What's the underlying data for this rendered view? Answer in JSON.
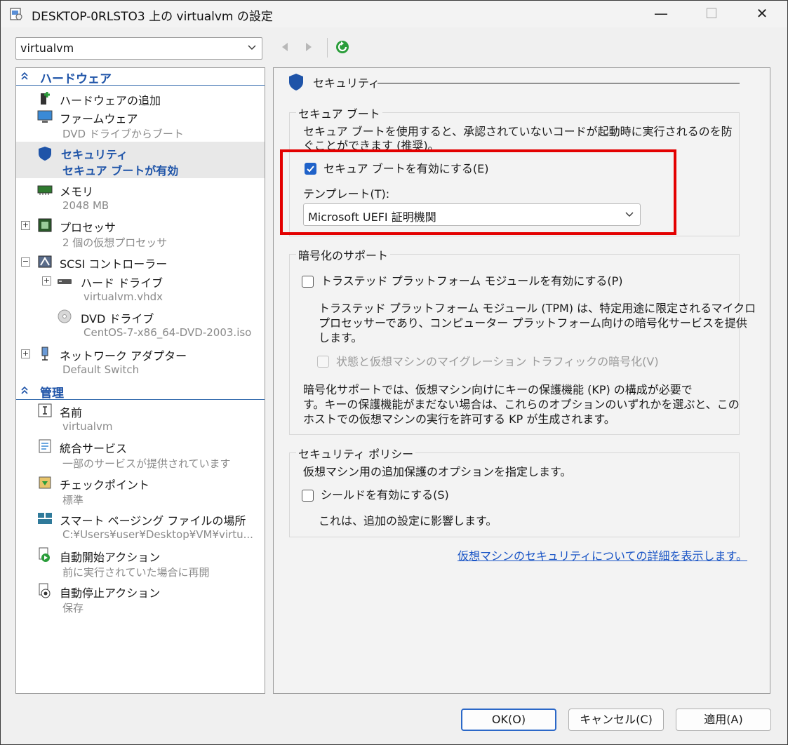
{
  "window": {
    "title": "DESKTOP-0RLSTO3 上の virtualvm の設定",
    "minimize": "—",
    "maximize": "☐",
    "close": "✕"
  },
  "vm_selector": {
    "value": "virtualvm"
  },
  "tree": {
    "hardware_header": "ハードウェア",
    "items": [
      {
        "label": "ハードウェアの追加",
        "sub": ""
      },
      {
        "label": "ファームウェア",
        "sub": "DVD ドライブからブート"
      },
      {
        "label": "セキュリティ",
        "sub": "セキュア ブートが有効"
      },
      {
        "label": "メモリ",
        "sub": "2048 MB"
      },
      {
        "label": "プロセッサ",
        "sub": "2 個の仮想プロセッサ"
      },
      {
        "label": "SCSI コントローラー",
        "sub": ""
      },
      {
        "label": "ハード ドライブ",
        "sub": "virtualvm.vhdx"
      },
      {
        "label": "DVD ドライブ",
        "sub": "CentOS-7-x86_64-DVD-2003.iso"
      },
      {
        "label": "ネットワーク アダプター",
        "sub": "Default Switch"
      }
    ],
    "management_header": "管理",
    "mgmt_items": [
      {
        "label": "名前",
        "sub": "virtualvm"
      },
      {
        "label": "統合サービス",
        "sub": "一部のサービスが提供されています"
      },
      {
        "label": "チェックポイント",
        "sub": "標準"
      },
      {
        "label": "スマート ページング ファイルの場所",
        "sub": "C:¥Users¥user¥Desktop¥VM¥virtu..."
      },
      {
        "label": "自動開始アクション",
        "sub": "前に実行されていた場合に再開"
      },
      {
        "label": "自動停止アクション",
        "sub": "保存"
      }
    ]
  },
  "security": {
    "title": "セキュリティ",
    "secure_boot": {
      "group_label": "セキュア ブート",
      "desc_line1": "セキュア ブートを使用すると、承認されていないコードが起動時に実行されるのを防",
      "desc_line2": "ぐことができます (推奨)。",
      "enable_label": "セキュア ブートを有効にする(E)",
      "enabled": true,
      "template_label": "テンプレート(T):",
      "template_value": "Microsoft UEFI 証明機関"
    },
    "encryption": {
      "group_label": "暗号化のサポート",
      "tpm_label": "トラステッド プラットフォーム モジュールを有効にする(P)",
      "tpm_enabled": false,
      "tpm_desc_line1": "トラステッド プラットフォーム モジュール (TPM) は、特定用途に限定されるマイクロ",
      "tpm_desc_line2": "プロセッサーであり、コンピューター プラットフォーム向けの暗号化サービスを提供",
      "tpm_desc_line3": "します。",
      "migration_label": "状態と仮想マシンのマイグレーション トラフィックの暗号化(V)",
      "kp_line1": "暗号化サポートでは、仮想マシン向けにキーの保護機能 (KP) の構成が必要で",
      "kp_line2": "す。キーの保護機能がまだない場合は、これらのオプションのいずれかを選ぶと、この",
      "kp_line3": "ホストでの仮想マシンの実行を許可する KP が生成されます。"
    },
    "policy": {
      "group_label": "セキュリティ ポリシー",
      "desc": "仮想マシン用の追加保護のオプションを指定します。",
      "shield_label": "シールドを有効にする(S)",
      "shield_enabled": false,
      "shield_note": "これは、追加の設定に影響します。"
    },
    "link": "仮想マシンのセキュリティについての詳細を表示します。"
  },
  "buttons": {
    "ok": "OK(O)",
    "cancel": "キャンセル(C)",
    "apply": "適用(A)"
  },
  "colors": {
    "accent": "#1f62c9",
    "highlight": "#e30000",
    "tree_header": "#1f54a8"
  }
}
